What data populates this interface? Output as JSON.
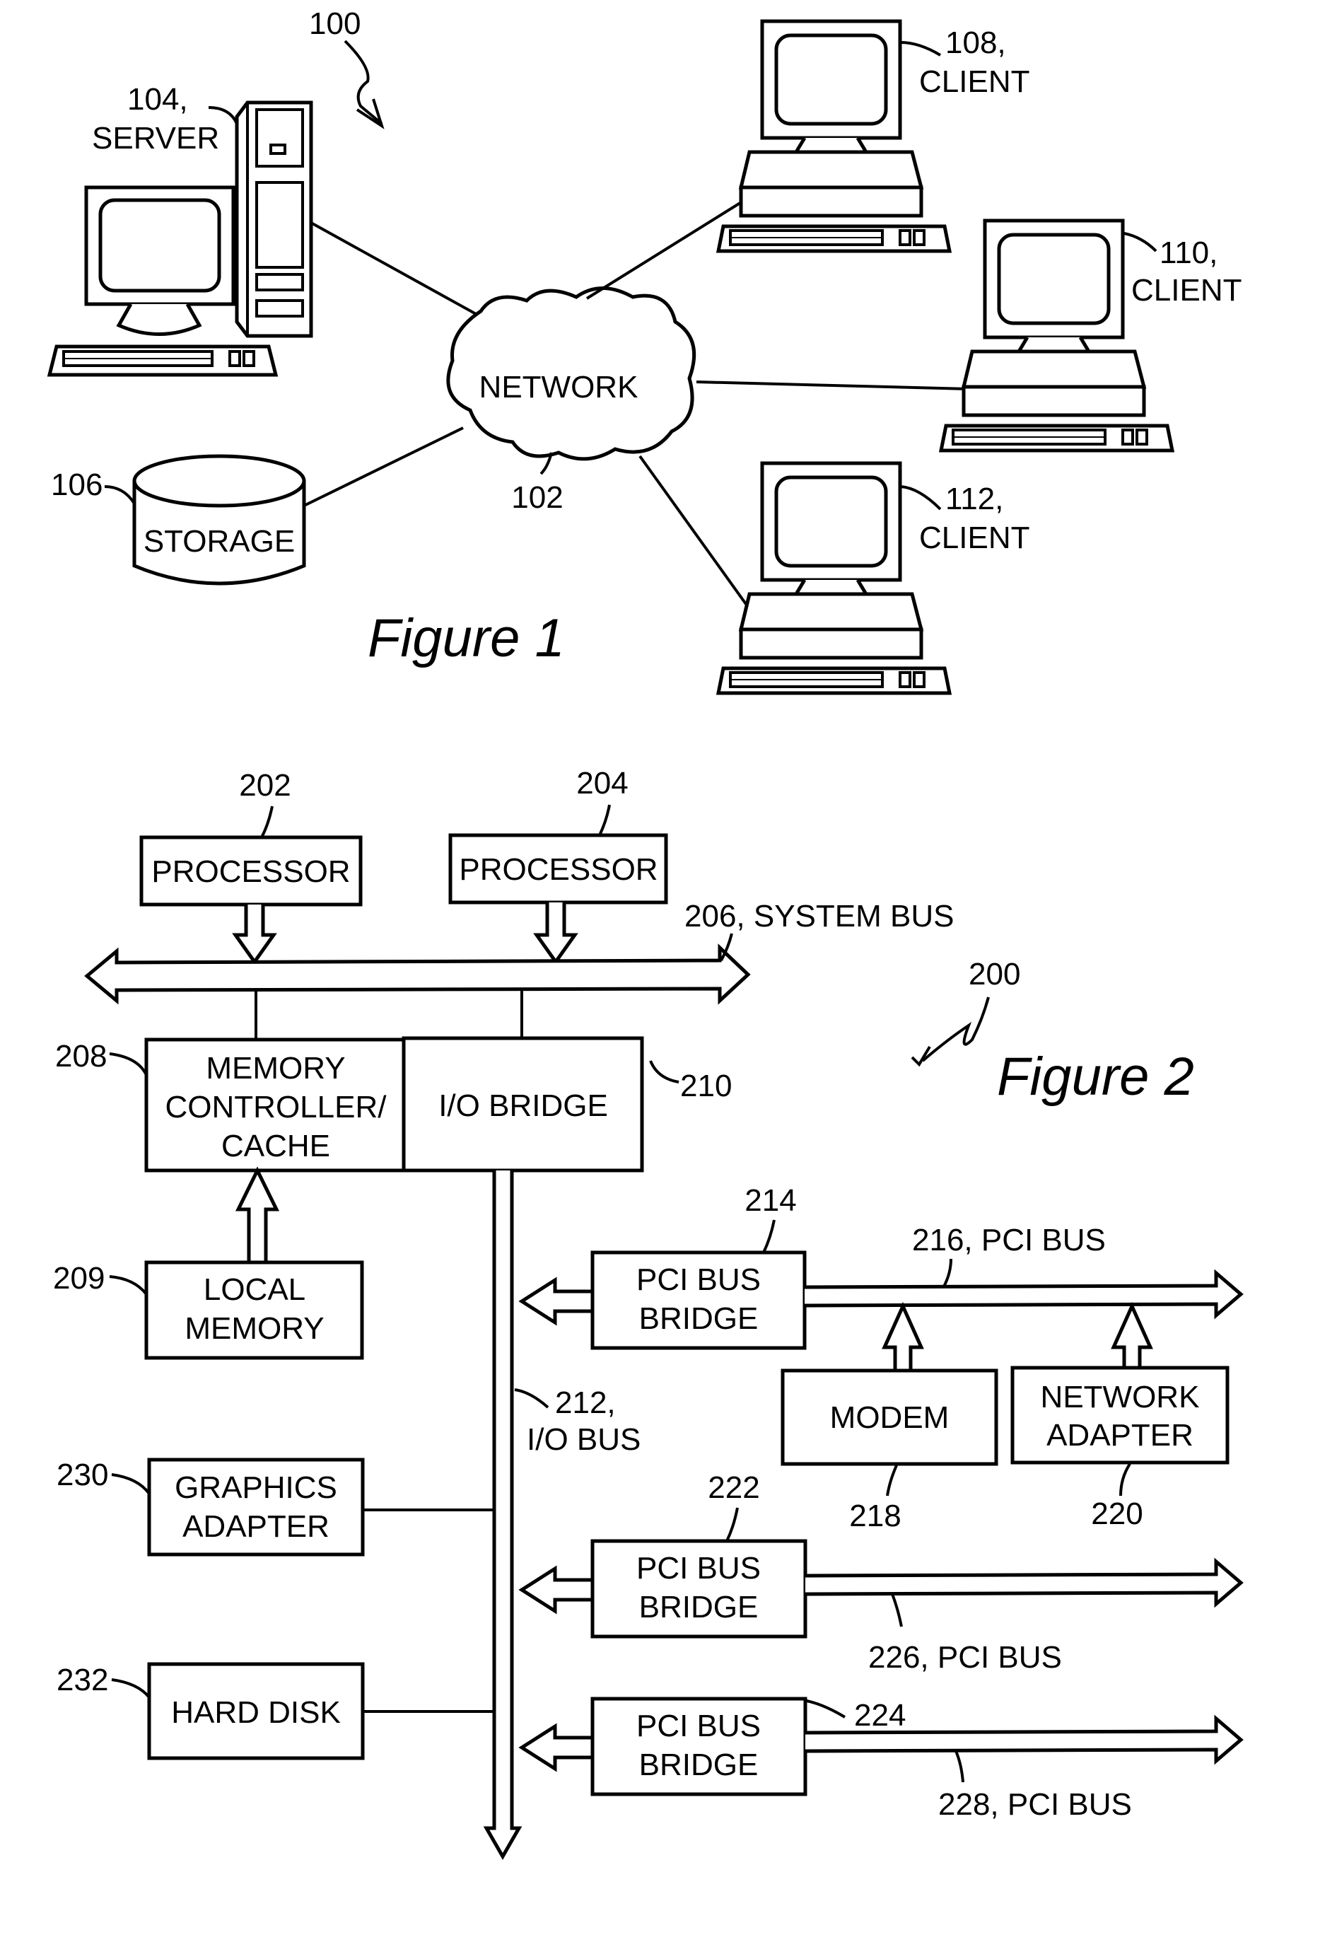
{
  "figure1": {
    "caption": "Figure 1",
    "ref": "100",
    "network": {
      "ref": "102",
      "label": "NETWORK"
    },
    "server": {
      "ref": "104,",
      "label": "SERVER"
    },
    "storage": {
      "ref": "106",
      "label": "STORAGE"
    },
    "clients": [
      {
        "ref": "108,",
        "label": "CLIENT"
      },
      {
        "ref": "110,",
        "label": "CLIENT"
      },
      {
        "ref": "112,",
        "label": "CLIENT"
      }
    ]
  },
  "figure2": {
    "caption": "Figure 2",
    "ref": "200",
    "processor1": {
      "ref": "202",
      "label": "PROCESSOR"
    },
    "processor2": {
      "ref": "204",
      "label": "PROCESSOR"
    },
    "system_bus": {
      "label": "206, SYSTEM BUS"
    },
    "memory_controller": {
      "ref": "208",
      "lines": [
        "MEMORY",
        "CONTROLLER/",
        "CACHE"
      ]
    },
    "io_bridge": {
      "ref": "210",
      "label": "I/O BRIDGE"
    },
    "local_memory": {
      "ref": "209",
      "lines": [
        "LOCAL",
        "MEMORY"
      ]
    },
    "io_bus": {
      "lines": [
        "212,",
        "I/O BUS"
      ]
    },
    "graphics_adapter": {
      "ref": "230",
      "lines": [
        "GRAPHICS",
        "ADAPTER"
      ]
    },
    "hard_disk": {
      "ref": "232",
      "label": "HARD DISK"
    },
    "pci_bridge1": {
      "ref": "214",
      "lines": [
        "PCI BUS",
        "BRIDGE"
      ]
    },
    "pci_bus1": {
      "label": "216, PCI BUS"
    },
    "modem": {
      "ref": "218",
      "label": "MODEM"
    },
    "network_adapter": {
      "ref": "220",
      "lines": [
        "NETWORK",
        "ADAPTER"
      ]
    },
    "pci_bridge2": {
      "ref": "222",
      "lines": [
        "PCI BUS",
        "BRIDGE"
      ]
    },
    "pci_bus2": {
      "label": "226, PCI BUS"
    },
    "pci_bridge3": {
      "ref": "224",
      "lines": [
        "PCI BUS",
        "BRIDGE"
      ]
    },
    "pci_bus3": {
      "label": "228, PCI BUS"
    }
  }
}
